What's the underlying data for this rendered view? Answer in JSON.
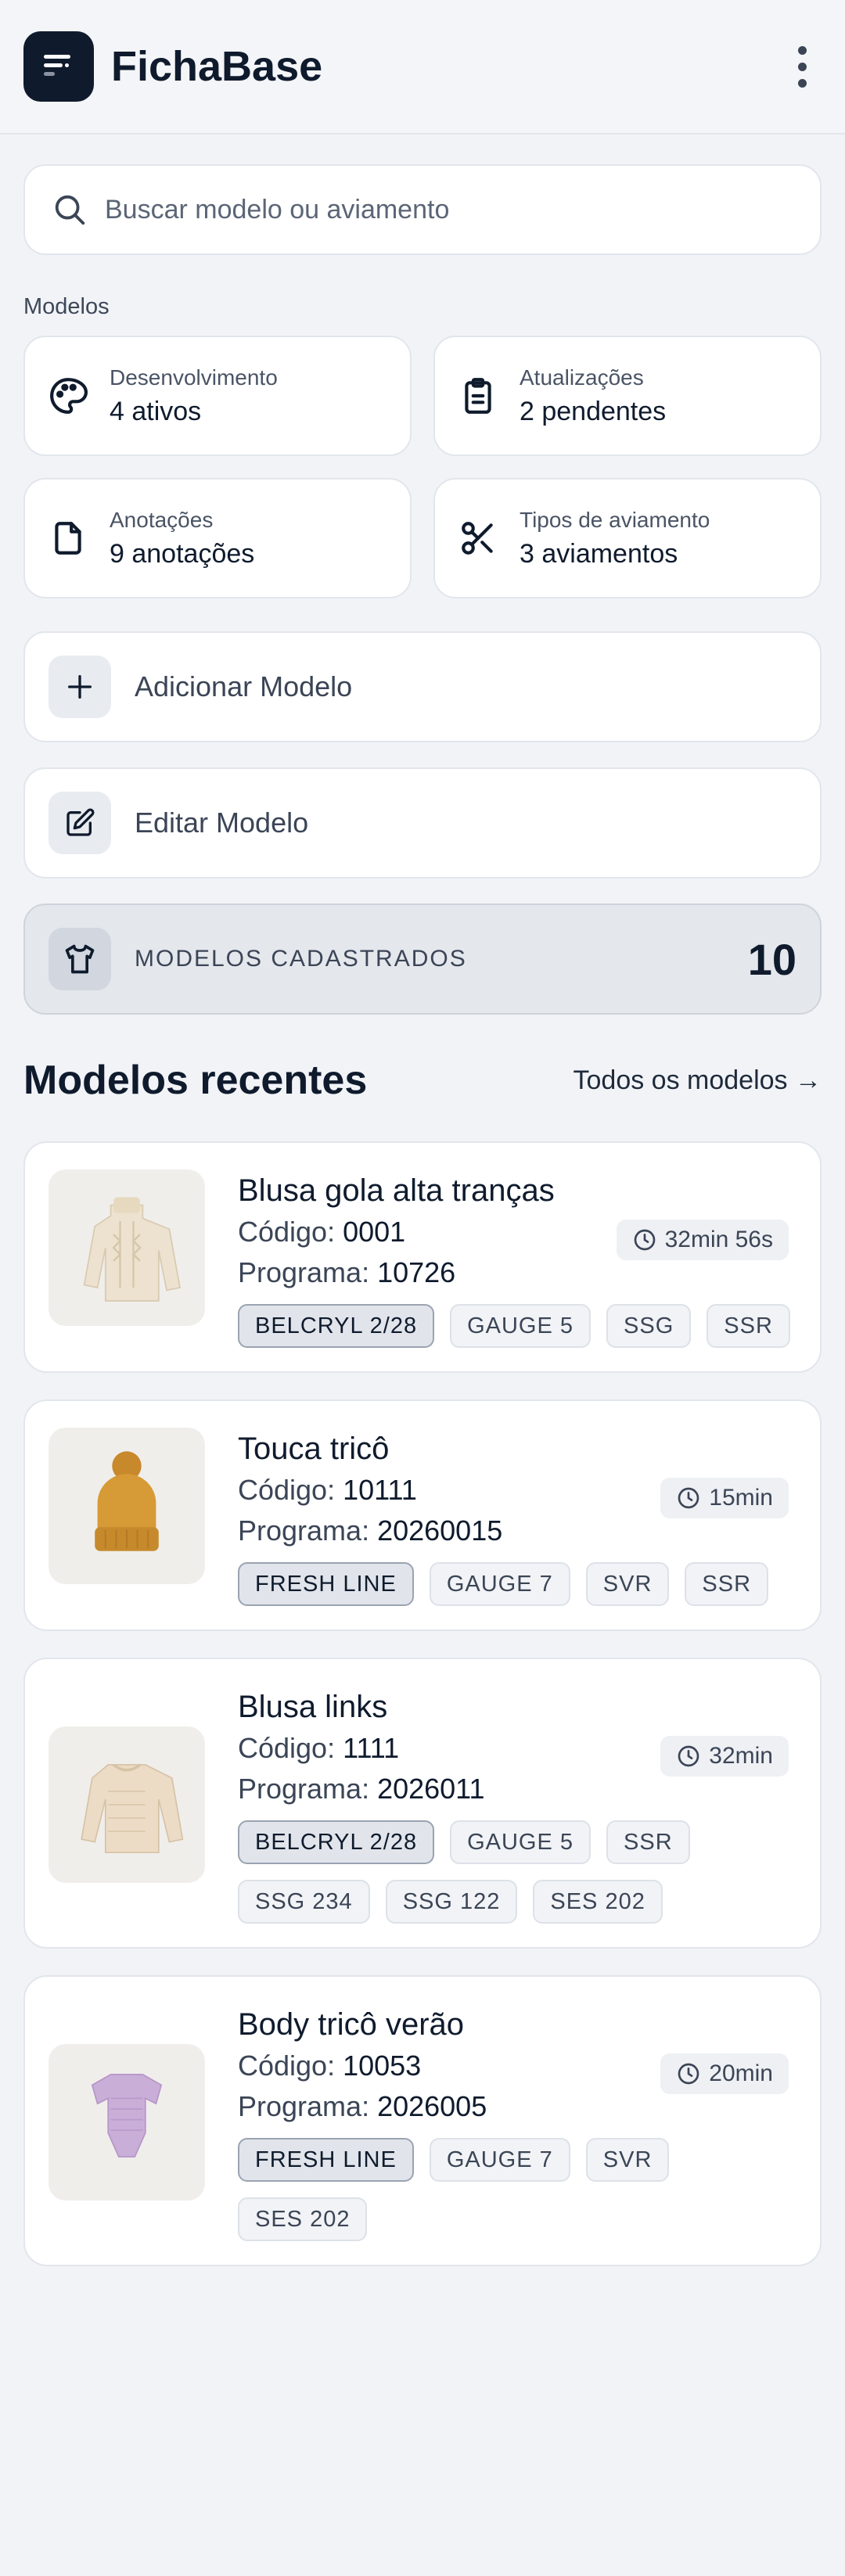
{
  "app": {
    "title": "FichaBase"
  },
  "search": {
    "placeholder": "Buscar modelo ou aviamento"
  },
  "section": {
    "label": "Modelos"
  },
  "stats": [
    {
      "label": "Desenvolvimento",
      "value": "4 ativos",
      "icon": "palette-icon"
    },
    {
      "label": "Atualizações",
      "value": "2 pendentes",
      "icon": "clipboard-icon"
    },
    {
      "label": "Anotações",
      "value": "9 anotações",
      "icon": "file-icon"
    },
    {
      "label": "Tipos de aviamento",
      "value": "3 aviamentos",
      "icon": "scissors-icon"
    }
  ],
  "actions": {
    "add": "Adicionar Modelo",
    "edit": "Editar Modelo"
  },
  "counter": {
    "label": "MODELOS CADASTRADOS",
    "value": "10"
  },
  "recent": {
    "title": "Modelos recentes",
    "link": "Todos os modelos →"
  },
  "labels": {
    "code": "Código: ",
    "program": "Programa: "
  },
  "models": [
    {
      "name": "Blusa gola alta tranças",
      "code": "0001",
      "program": "10726",
      "time": "32min 56s",
      "tags": [
        "BELCRYL 2/28",
        "GAUGE 5",
        "SSG",
        "SSR"
      ],
      "thumb": "cream-turtleneck-sweater"
    },
    {
      "name": "Touca tricô",
      "code": "10111",
      "program": "20260015",
      "time": "15min",
      "tags": [
        "FRESH LINE",
        "GAUGE 7",
        "SVR",
        "SSR"
      ],
      "thumb": "mustard-beanie"
    },
    {
      "name": "Blusa links",
      "code": "1111",
      "program": "2026011",
      "time": "32min",
      "tags": [
        "BELCRYL 2/28",
        "GAUGE 5",
        "SSR",
        "SSG 234",
        "SSG 122",
        "SES 202"
      ],
      "thumb": "beige-knit-sweater"
    },
    {
      "name": "Body tricô verão",
      "code": "10053",
      "program": "2026005",
      "time": "20min",
      "tags": [
        "FRESH LINE",
        "GAUGE 7",
        "SVR",
        "SES 202"
      ],
      "thumb": "lilac-bodysuit"
    }
  ]
}
